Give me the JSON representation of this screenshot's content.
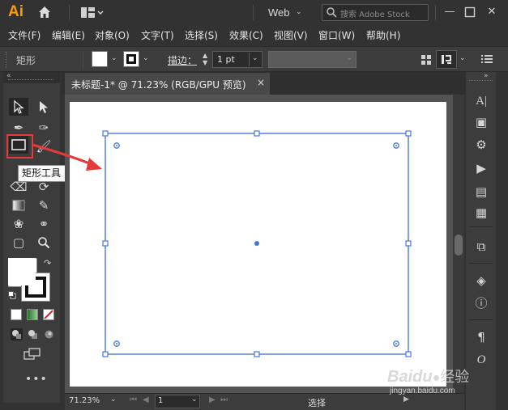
{
  "app": {
    "logo": "Ai",
    "workspace": "Web",
    "search_placeholder": "搜索 Adobe Stock"
  },
  "menu": [
    "文件(F)",
    "编辑(E)",
    "对象(O)",
    "文字(T)",
    "选择(S)",
    "效果(C)",
    "视图(V)",
    "窗口(W)",
    "帮助(H)"
  ],
  "control": {
    "tool_name": "矩形",
    "stroke_label": "描边：",
    "stroke_value": "1 pt"
  },
  "document": {
    "tab_title": "未标题-1* @ 71.23% (RGB/GPU 预览)",
    "close": "×"
  },
  "status": {
    "zoom": "71.23%",
    "page": "1",
    "tool": "选择"
  },
  "tooltip": "矩形工具 (M)",
  "watermark": {
    "brand": "Baidu",
    "brand_cn": "经验",
    "url": "jingyan.baidu.com"
  },
  "colors": {
    "accent_selection": "#4a78d6",
    "highlight_red": "#e33b3b",
    "ai_orange": "#ff9a00"
  }
}
